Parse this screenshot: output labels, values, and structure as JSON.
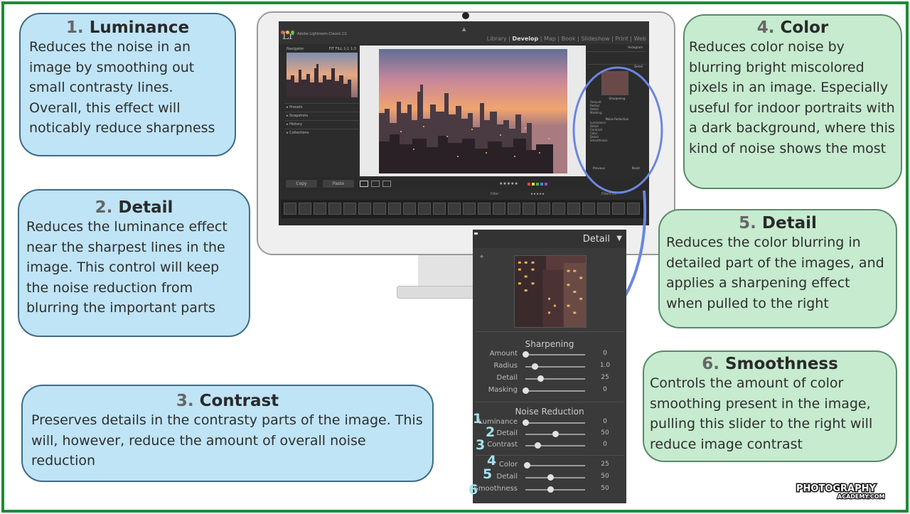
{
  "callouts": [
    {
      "num": "1.",
      "title": "Luminance",
      "body": "Reduces the noise in an image by smoothing out small contrasty lines. Overall, this effect will noticably reduce sharpness"
    },
    {
      "num": "2.",
      "title": "Detail",
      "body": "Reduces the luminance effect near the sharpest lines in the image. This control will keep the noise reduction from blurring the important parts"
    },
    {
      "num": "3.",
      "title": "Contrast",
      "body": "Preserves details in the contrasty parts of the image. This will, however, reduce the amount of overall noise reduction"
    },
    {
      "num": "4.",
      "title": "Color",
      "body": "Reduces color noise by blurring bright miscolored pixels in an image. Especially useful for indoor portraits with a dark background, where this kind of noise shows the most"
    },
    {
      "num": "5.",
      "title": "Detail",
      "body": "Reduces the color blurring in detailed part of the images, and applies a sharpening effect when pulled to the right"
    },
    {
      "num": "6.",
      "title": "Smoothness",
      "body": "Controls the amount of color smoothing present in the image, pulling this slider to the right will reduce image contrast"
    }
  ],
  "lightroom": {
    "logo": "Lr",
    "app_name": "Adobe Lightroom Classic CC",
    "modules": [
      "Library",
      "Develop",
      "Map",
      "Book",
      "Slideshow",
      "Print",
      "Web"
    ],
    "active_module": "Develop",
    "navigator": "Navigator",
    "nav_zoom": "FIT  FILL  1:1  1:3",
    "left_panels": [
      "Presets",
      "Snapshots",
      "History",
      "Collections"
    ],
    "histogram": "Histogram",
    "copy": "Copy",
    "paste": "Paste",
    "stars": "★★★★★",
    "filter": "Filter:",
    "filters_off": "Filters Off",
    "previous": "Previous",
    "reset": "Reset",
    "mini_detail": "Detail",
    "mini_sharpening": "Sharpening",
    "mini_sharp_labels": [
      "Amount",
      "Radius",
      "Detail",
      "Masking"
    ],
    "mini_noise": "Noise Reduction",
    "mini_noise_labels": [
      "Luminance",
      "Detail",
      "Contrast",
      "Color",
      "Detail",
      "Smoothness"
    ]
  },
  "detail_panel": {
    "title": "Detail",
    "sharpening_title": "Sharpening",
    "sharpening": [
      {
        "label": "Amount",
        "value": "0",
        "position": 0.0
      },
      {
        "label": "Radius",
        "value": "1.0",
        "position": 0.16
      },
      {
        "label": "Detail",
        "value": "25",
        "position": 0.25
      },
      {
        "label": "Masking",
        "value": "0",
        "position": 0.0
      }
    ],
    "noise_title": "Noise Reduction",
    "luminance_group": [
      {
        "label": "Luminance",
        "value": "0",
        "position": 0.0,
        "marker": "1"
      },
      {
        "label": "Detail",
        "value": "50",
        "position": 0.5,
        "marker": "2"
      },
      {
        "label": "Contrast",
        "value": "0",
        "position": 0.2,
        "marker": "3"
      }
    ],
    "color_group": [
      {
        "label": "Color",
        "value": "25",
        "position": 0.02,
        "marker": "4"
      },
      {
        "label": "Detail",
        "value": "50",
        "position": 0.42,
        "marker": "5"
      },
      {
        "label": "Smoothness",
        "value": "50",
        "position": 0.42,
        "marker": "6"
      }
    ]
  },
  "brand": {
    "line1": "PHOTOGRAPHY",
    "line2": "ACADEMY.COM"
  },
  "colors": {
    "frame": "#1f8a3a",
    "blue_bubble": "#bfe4f6",
    "green_bubble": "#c6ebcf",
    "highlight": "#6b86e0"
  }
}
